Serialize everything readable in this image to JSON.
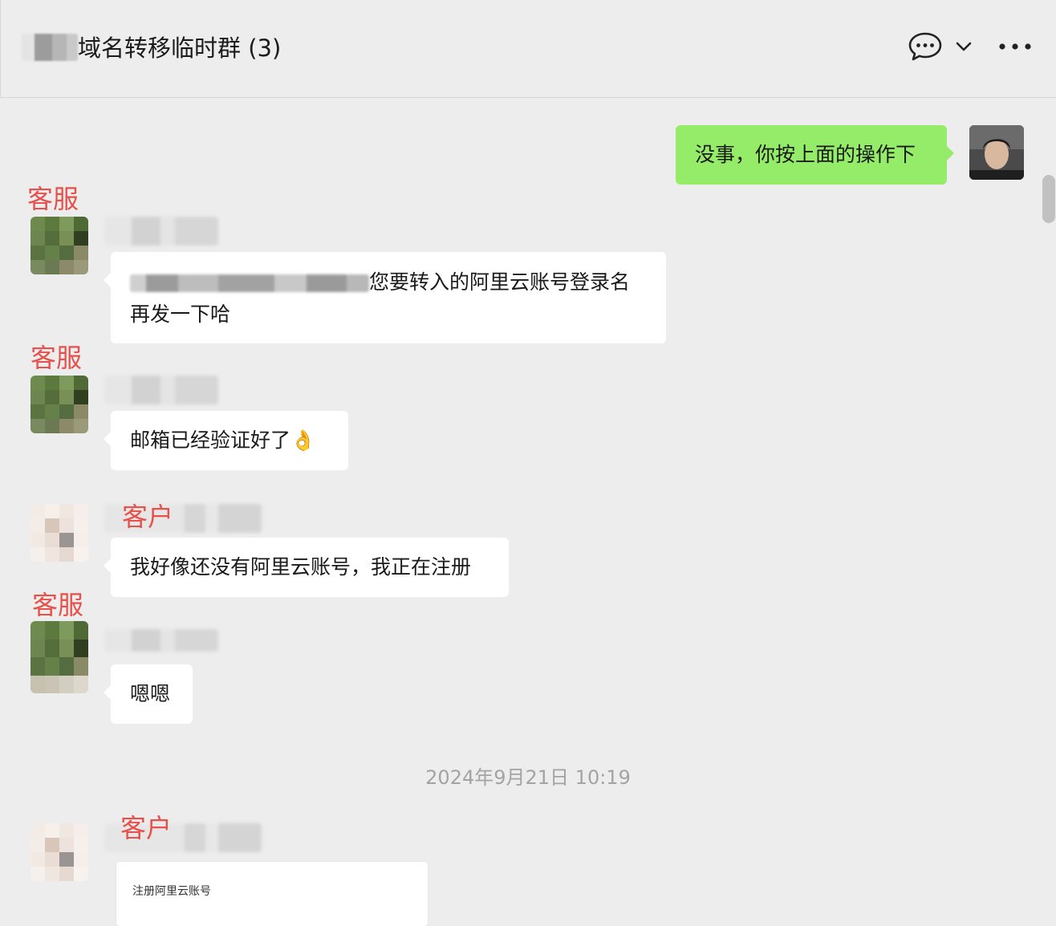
{
  "header": {
    "title": "域名转移临时群 (3)",
    "icons": [
      "chat-bubble-icon",
      "chevron-down-icon",
      "more-dots-icon"
    ]
  },
  "messages": [
    {
      "from": "me",
      "text": "没事，你按上面的操作下"
    },
    {
      "from": "other",
      "role_label": "客服",
      "text": "您要转入的阿里云账号登录名再发一下哈",
      "text_line1": "您要转入的阿里云账号登录名",
      "text_line2": "再发一下哈"
    },
    {
      "from": "other",
      "role_label": "客服",
      "text": "邮箱已经验证好了",
      "emoji": "👌"
    },
    {
      "from": "other",
      "role_label": "客户",
      "text": "我好像还没有阿里云账号，我正在注册"
    },
    {
      "from": "other",
      "role_label": "客服",
      "text": "嗯嗯"
    },
    {
      "from": "other",
      "role_label": "客户",
      "card_title": "注册阿里云账号"
    }
  ],
  "timestamp": "2024年9月21日 10:19",
  "colors": {
    "background": "#ededed",
    "my_bubble": "#95ec69",
    "other_bubble": "#ffffff",
    "annotation_red": "#e8504b",
    "timestamp": "#a3a3a3"
  }
}
